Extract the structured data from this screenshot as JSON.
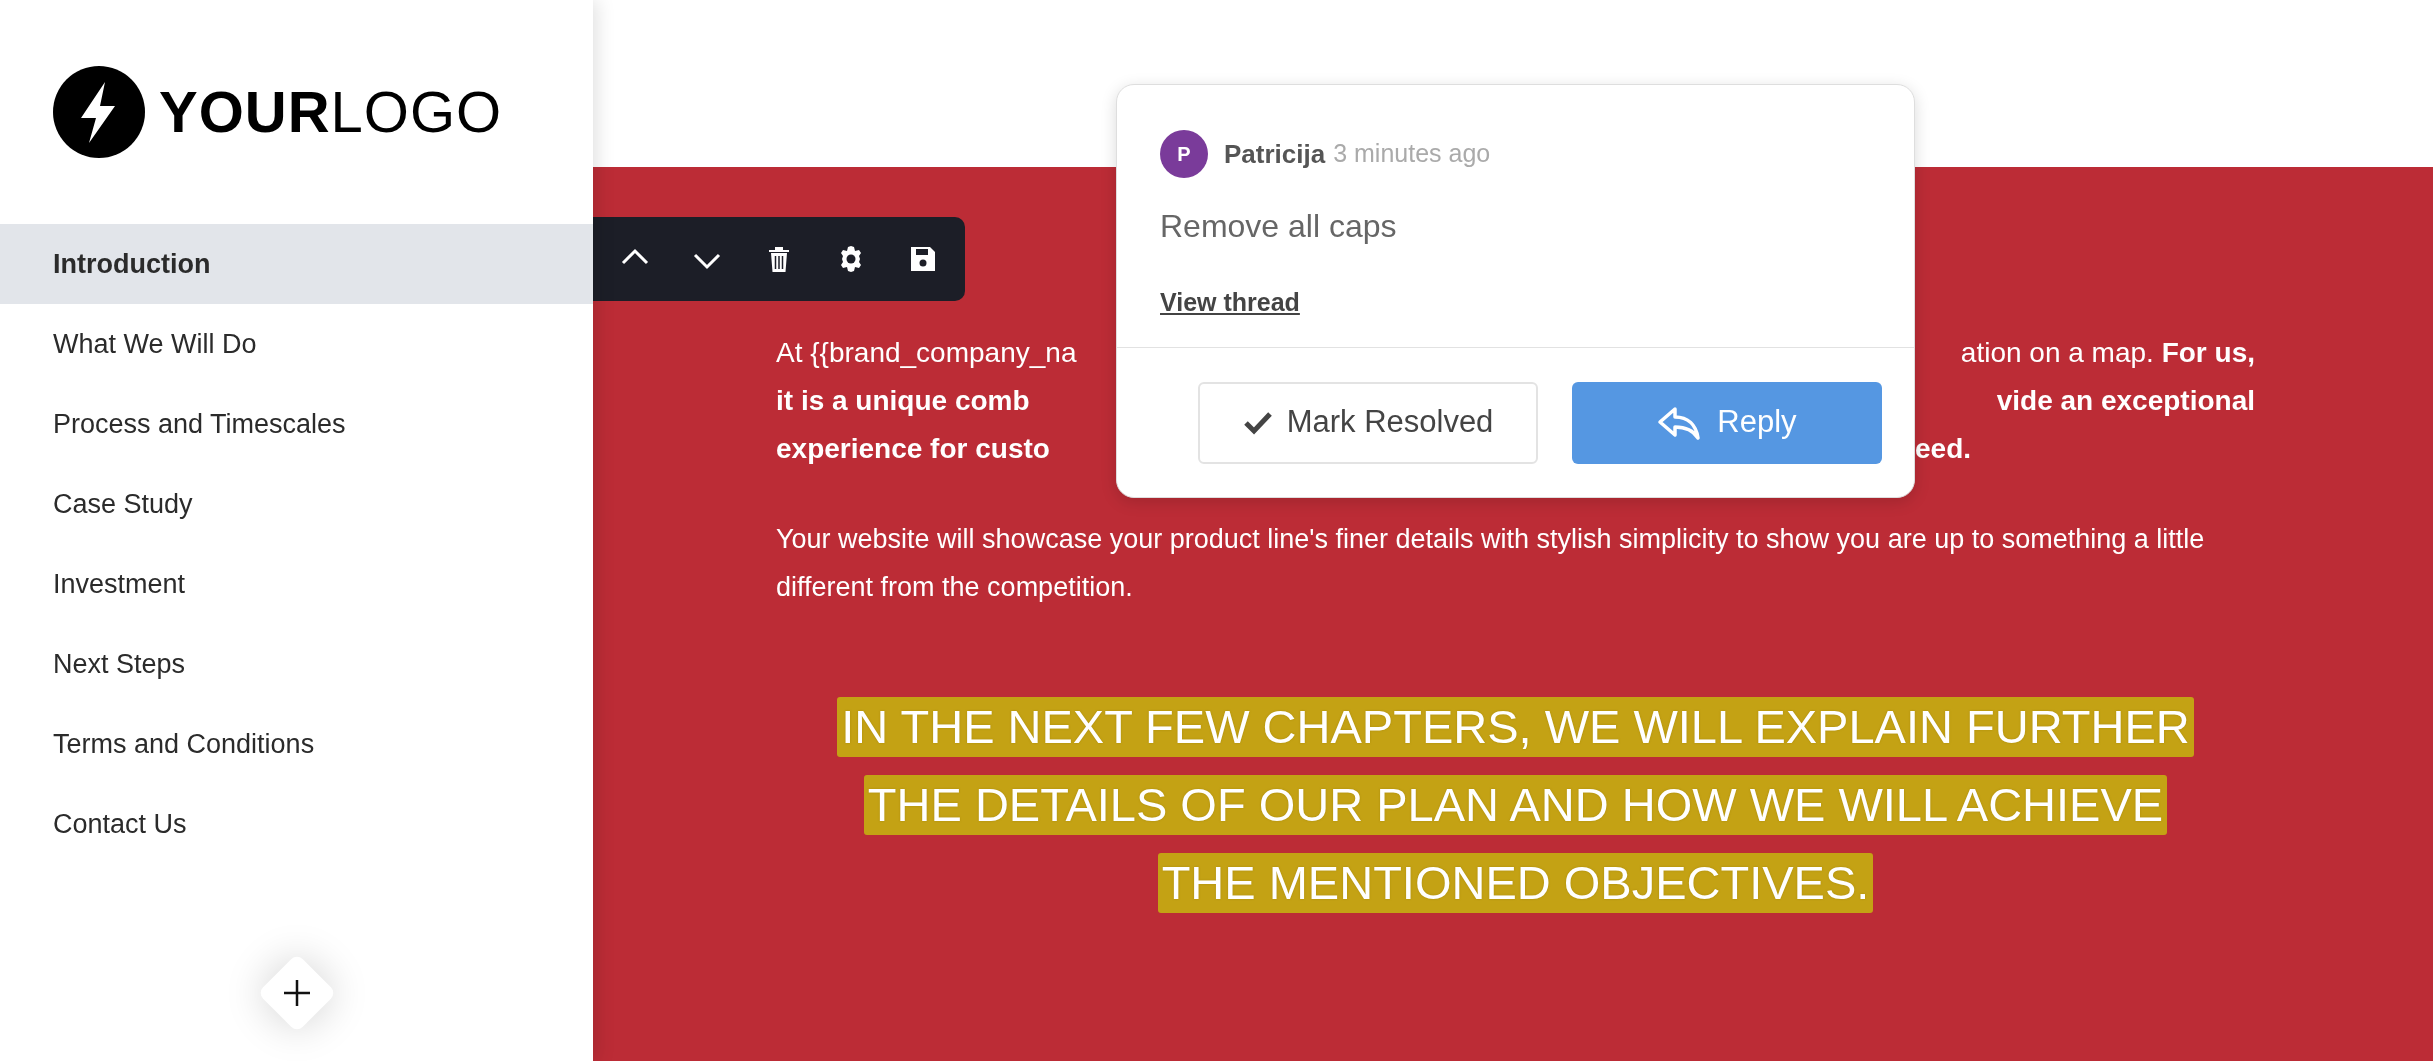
{
  "logo": {
    "bold": "YOUR",
    "light": "LOGO"
  },
  "nav": [
    {
      "label": "Introduction",
      "selected": true
    },
    {
      "label": "What We Will Do",
      "selected": false
    },
    {
      "label": "Process and Timescales",
      "selected": false
    },
    {
      "label": "Case Study",
      "selected": false
    },
    {
      "label": "Investment",
      "selected": false
    },
    {
      "label": "Next Steps",
      "selected": false
    },
    {
      "label": "Terms and Conditions",
      "selected": false
    },
    {
      "label": "Contact Us",
      "selected": false
    }
  ],
  "toolbar": [
    {
      "kind": "up"
    },
    {
      "kind": "down"
    },
    {
      "kind": "delete"
    },
    {
      "kind": "settings"
    },
    {
      "kind": "save"
    }
  ],
  "comment": {
    "avatar": "P",
    "author": "Patricija",
    "time": "3 minutes ago",
    "text": "Remove all caps",
    "link": "View thread",
    "buttons": [
      {
        "label": "Mark Resolved",
        "kind": "secondary"
      },
      {
        "label": "Reply",
        "kind": "primary"
      }
    ]
  },
  "paragraph_1_lines": [
    {
      "left": {
        "text": "At {{brand_company_na",
        "bold": false
      },
      "right": {
        "text": "ation on a map. **For us,**",
        "bold": false
      }
    },
    {
      "left": {
        "text": "it is a unique comb",
        "bold": true
      },
      "right": {
        "text": "vide an exceptional",
        "bold": true
      }
    },
    {
      "left": {
        "text": "experience for custo",
        "bold": true
      },
      "right": {
        "text": "eed.",
        "bold": true
      }
    }
  ],
  "paragraph_2": "Your website will showcase your product line's finer details with stylish simplicity to show you are up to something a little different from the competition.",
  "highlighted_heading_lines": [
    "IN THE NEXT FEW CHAPTERS, WE WILL EXPLAIN FURTHER",
    "THE DETAILS OF OUR PLAN AND HOW WE WILL ACHIEVE",
    "THE MENTIONED OBJECTIVES."
  ]
}
